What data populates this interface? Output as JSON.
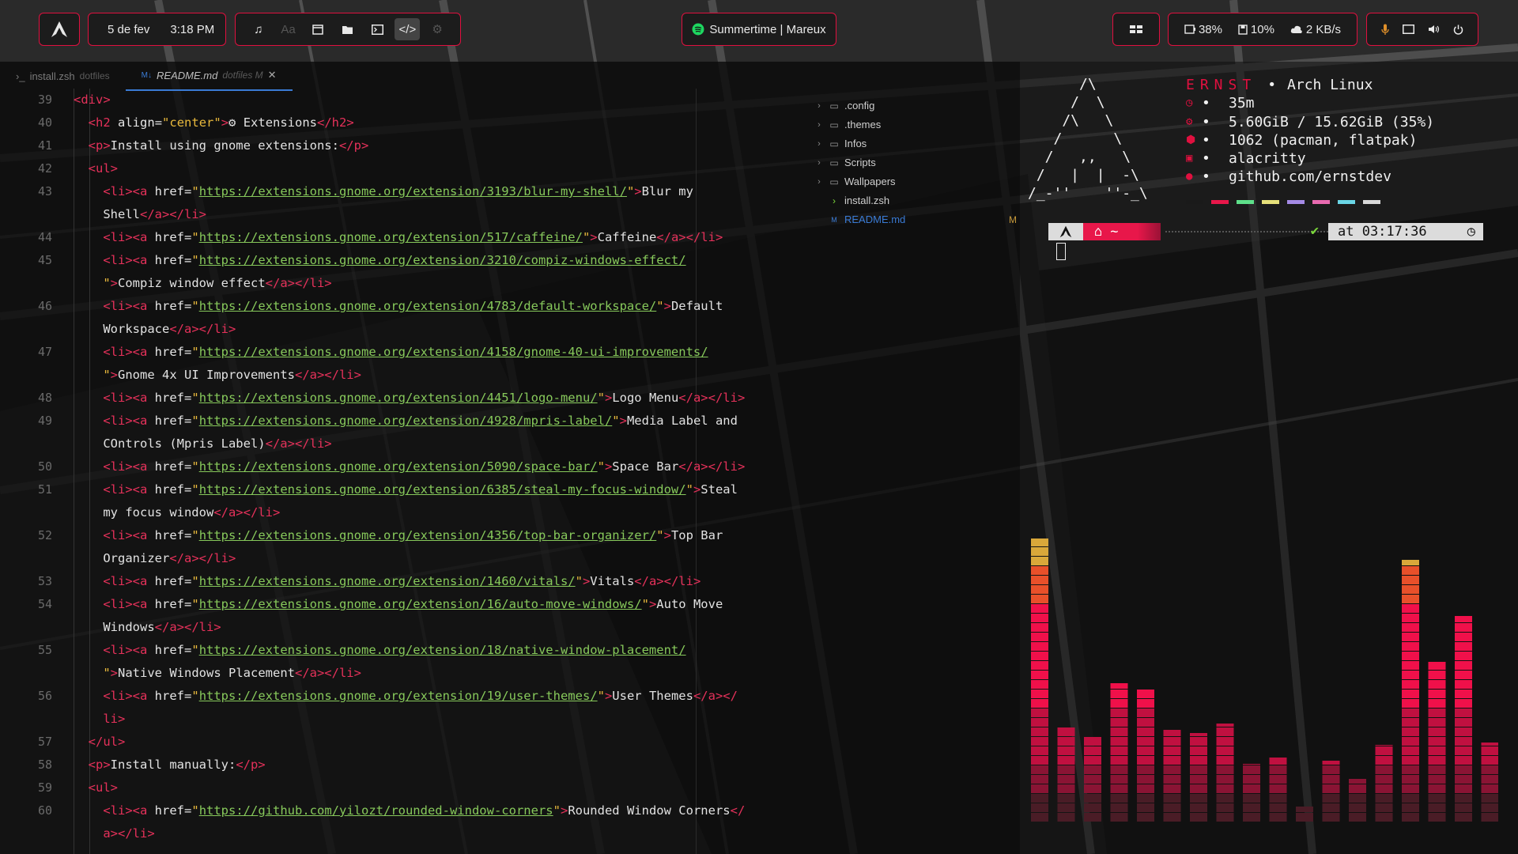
{
  "topbar": {
    "date": "5 de fev",
    "time": "3:18 PM",
    "media": "Summertime | Mareux",
    "battery": "38%",
    "storage": "10%",
    "network": "2 KB/s"
  },
  "colors": {
    "accent": "#e0103f",
    "string": "#e9b93c",
    "url": "#87c95b",
    "tag": "#e5315a"
  },
  "editor": {
    "tabs": [
      {
        "label": "install.zsh",
        "sub": "dotfiles",
        "active": false
      },
      {
        "label": "README.md",
        "sub": "dotfiles M",
        "active": true
      }
    ],
    "lines": [
      {
        "n": "39",
        "html": "<span class='tg'>&lt;div&gt;</span>",
        "indent": 0
      },
      {
        "n": "40",
        "html": "  <span class='tg'>&lt;h2</span> <span class='at'>align</span>=<span class='st'>\"center\"</span><span class='tg'>&gt;</span>⚙ Extensions<span class='tg'>&lt;/h2&gt;</span>"
      },
      {
        "n": "41",
        "html": "  <span class='tg'>&lt;p&gt;</span>Install using gnome extensions:<span class='tg'>&lt;/p&gt;</span>"
      },
      {
        "n": "42",
        "html": "  <span class='tg'>&lt;ul&gt;</span>"
      },
      {
        "n": "43",
        "html": "    <span class='tg'>&lt;li&gt;&lt;a</span> <span class='at'>href</span>=<span class='st'>\"</span><span class='ur'>https://extensions.gnome.org/extension/3193/blur-my-shell/</span><span class='st'>\"</span><span class='tg'>&gt;</span>Blur my"
      },
      {
        "n": "",
        "html": "    Shell<span class='tg'>&lt;/a&gt;&lt;/li&gt;</span>"
      },
      {
        "n": "44",
        "html": "    <span class='tg'>&lt;li&gt;&lt;a</span> <span class='at'>href</span>=<span class='st'>\"</span><span class='ur'>https://extensions.gnome.org/extension/517/caffeine/</span><span class='st'>\"</span><span class='tg'>&gt;</span>Caffeine<span class='tg'>&lt;/a&gt;&lt;/li&gt;</span>"
      },
      {
        "n": "45",
        "html": "    <span class='tg'>&lt;li&gt;&lt;a</span> <span class='at'>href</span>=<span class='st'>\"</span><span class='ur'>https://extensions.gnome.org/extension/3210/compiz-windows-effect/</span>"
      },
      {
        "n": "",
        "html": "    <span class='st'>\"</span><span class='tg'>&gt;</span>Compiz window effect<span class='tg'>&lt;/a&gt;&lt;/li&gt;</span>"
      },
      {
        "n": "46",
        "html": "    <span class='tg'>&lt;li&gt;&lt;a</span> <span class='at'>href</span>=<span class='st'>\"</span><span class='ur'>https://extensions.gnome.org/extension/4783/default-workspace/</span><span class='st'>\"</span><span class='tg'>&gt;</span>Default"
      },
      {
        "n": "",
        "html": "    Workspace<span class='tg'>&lt;/a&gt;&lt;/li&gt;</span>"
      },
      {
        "n": "47",
        "html": "    <span class='tg'>&lt;li&gt;&lt;a</span> <span class='at'>href</span>=<span class='st'>\"</span><span class='ur'>https://extensions.gnome.org/extension/4158/gnome-40-ui-improvements/</span>"
      },
      {
        "n": "",
        "html": "    <span class='st'>\"</span><span class='tg'>&gt;</span>Gnome 4x UI Improvements<span class='tg'>&lt;/a&gt;&lt;/li&gt;</span>"
      },
      {
        "n": "48",
        "html": "    <span class='tg'>&lt;li&gt;&lt;a</span> <span class='at'>href</span>=<span class='st'>\"</span><span class='ur'>https://extensions.gnome.org/extension/4451/logo-menu/</span><span class='st'>\"</span><span class='tg'>&gt;</span>Logo Menu<span class='tg'>&lt;/a&gt;&lt;/li&gt;</span>"
      },
      {
        "n": "49",
        "html": "    <span class='tg'>&lt;li&gt;&lt;a</span> <span class='at'>href</span>=<span class='st'>\"</span><span class='ur'>https://extensions.gnome.org/extension/4928/mpris-label/</span><span class='st'>\"</span><span class='tg'>&gt;</span>Media Label and"
      },
      {
        "n": "",
        "html": "    COntrols (Mpris Label)<span class='tg'>&lt;/a&gt;&lt;/li&gt;</span>"
      },
      {
        "n": "50",
        "html": "    <span class='tg'>&lt;li&gt;&lt;a</span> <span class='at'>href</span>=<span class='st'>\"</span><span class='ur'>https://extensions.gnome.org/extension/5090/space-bar/</span><span class='st'>\"</span><span class='tg'>&gt;</span>Space Bar<span class='tg'>&lt;/a&gt;&lt;/li&gt;</span>"
      },
      {
        "n": "51",
        "html": "    <span class='tg'>&lt;li&gt;&lt;a</span> <span class='at'>href</span>=<span class='st'>\"</span><span class='ur'>https://extensions.gnome.org/extension/6385/steal-my-focus-window/</span><span class='st'>\"</span><span class='tg'>&gt;</span>Steal"
      },
      {
        "n": "",
        "html": "    my focus window<span class='tg'>&lt;/a&gt;&lt;/li&gt;</span>"
      },
      {
        "n": "52",
        "html": "    <span class='tg'>&lt;li&gt;&lt;a</span> <span class='at'>href</span>=<span class='st'>\"</span><span class='ur'>https://extensions.gnome.org/extension/4356/top-bar-organizer/</span><span class='st'>\"</span><span class='tg'>&gt;</span>Top Bar"
      },
      {
        "n": "",
        "html": "    Organizer<span class='tg'>&lt;/a&gt;&lt;/li&gt;</span>"
      },
      {
        "n": "53",
        "html": "    <span class='tg'>&lt;li&gt;&lt;a</span> <span class='at'>href</span>=<span class='st'>\"</span><span class='ur'>https://extensions.gnome.org/extension/1460/vitals/</span><span class='st'>\"</span><span class='tg'>&gt;</span>Vitals<span class='tg'>&lt;/a&gt;&lt;/li&gt;</span>"
      },
      {
        "n": "54",
        "html": "    <span class='tg'>&lt;li&gt;&lt;a</span> <span class='at'>href</span>=<span class='st'>\"</span><span class='ur'>https://extensions.gnome.org/extension/16/auto-move-windows/</span><span class='st'>\"</span><span class='tg'>&gt;</span>Auto Move"
      },
      {
        "n": "",
        "html": "    Windows<span class='tg'>&lt;/a&gt;&lt;/li&gt;</span>"
      },
      {
        "n": "55",
        "html": "    <span class='tg'>&lt;li&gt;&lt;a</span> <span class='at'>href</span>=<span class='st'>\"</span><span class='ur'>https://extensions.gnome.org/extension/18/native-window-placement/</span>"
      },
      {
        "n": "",
        "html": "    <span class='st'>\"</span><span class='tg'>&gt;</span>Native Windows Placement<span class='tg'>&lt;/a&gt;&lt;/li&gt;</span>"
      },
      {
        "n": "56",
        "html": "    <span class='tg'>&lt;li&gt;&lt;a</span> <span class='at'>href</span>=<span class='st'>\"</span><span class='ur'>https://extensions.gnome.org/extension/19/user-themes/</span><span class='st'>\"</span><span class='tg'>&gt;</span>User Themes<span class='tg'>&lt;/a&gt;&lt;/</span>"
      },
      {
        "n": "",
        "html": "    <span class='tg'>li&gt;</span>"
      },
      {
        "n": "57",
        "html": "  <span class='tg'>&lt;/ul&gt;</span>"
      },
      {
        "n": "58",
        "html": "  <span class='tg'>&lt;p&gt;</span>Install manually:<span class='tg'>&lt;/p&gt;</span>"
      },
      {
        "n": "59",
        "html": "  <span class='tg'>&lt;ul&gt;</span>"
      },
      {
        "n": "60",
        "html": "    <span class='tg'>&lt;li&gt;&lt;a</span> <span class='at'>href</span>=<span class='st'>\"</span><span class='ur'>https://github.com/yilozt/rounded-window-corners</span><span class='st'>\"</span><span class='tg'>&gt;</span>Rounded Window Corners<span class='tg'>&lt;/</span>"
      },
      {
        "n": "",
        "html": "    <span class='tg'>a&gt;&lt;/li&gt;</span>"
      }
    ]
  },
  "tree": [
    {
      "label": ".config",
      "type": "folder"
    },
    {
      "label": ".themes",
      "type": "folder"
    },
    {
      "label": "Infos",
      "type": "folder"
    },
    {
      "label": "Scripts",
      "type": "folder"
    },
    {
      "label": "Wallpapers",
      "type": "folder"
    },
    {
      "label": "install.zsh",
      "type": "shell"
    },
    {
      "label": "README.md",
      "type": "markdown",
      "badge": "M",
      "open": true
    }
  ],
  "fetch": {
    "title": "ERNST",
    "os": "Arch Linux",
    "rows": [
      "35m",
      "5.60GiB / 15.62GiB (35%)",
      "1062 (pacman, flatpak)",
      "alacritty",
      "github.com/ernstdev"
    ],
    "ascii": "      /\\\n     /  \\\n    /\\   \\\n   /      \\\n  /   ,,   \\\n /   |  |  -\\\n/_-''    ''-_\\"
  },
  "prompt": {
    "path": "~",
    "time": "at 03:17:36"
  },
  "swatch_colors": [
    "#1a1a1a",
    "#e8174a",
    "#5ee08a",
    "#e6e07a",
    "#a58be6",
    "#e86ab0",
    "#6ad6e6",
    "#d8d8d8"
  ],
  "visualizer": [
    0.92,
    0.31,
    0.28,
    0.45,
    0.43,
    0.3,
    0.29,
    0.32,
    0.19,
    0.21,
    0.05,
    0.2,
    0.14,
    0.25,
    0.85,
    0.52,
    0.67,
    0.26
  ]
}
